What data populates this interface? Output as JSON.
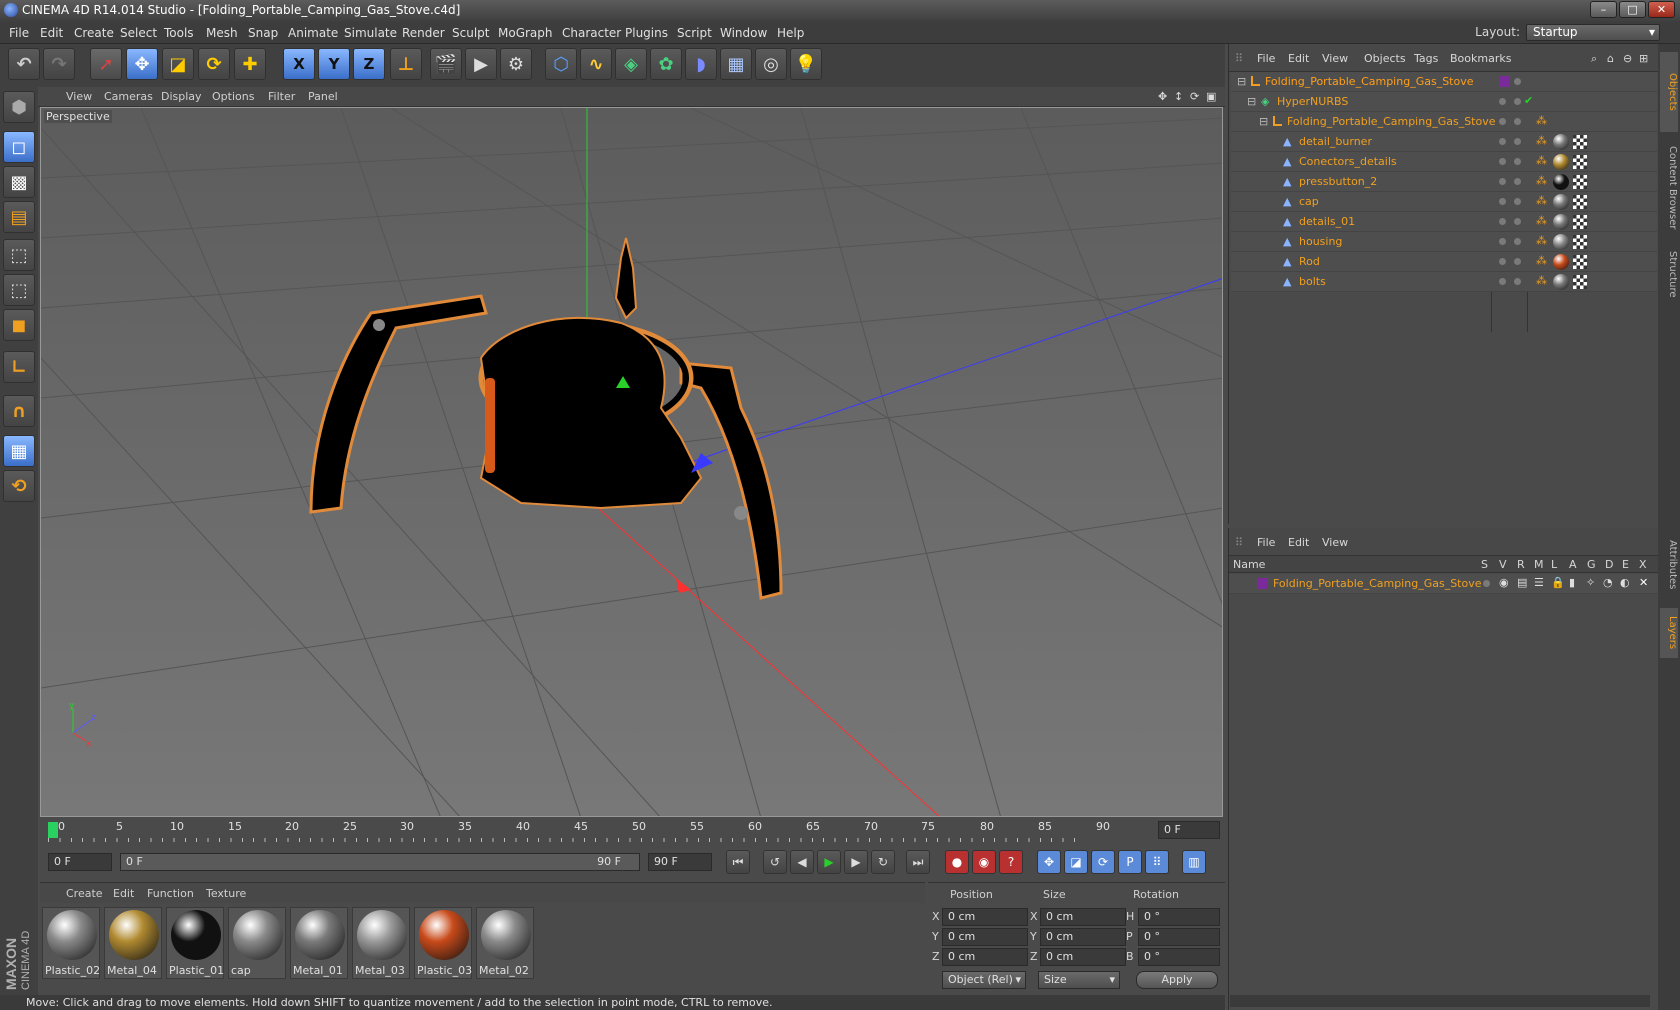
{
  "window": {
    "title": "CINEMA 4D R14.014 Studio - [Folding_Portable_Camping_Gas_Stove.c4d]",
    "buttons": {
      "min": "–",
      "max": "□",
      "close": "✕"
    }
  },
  "menubar": {
    "items": [
      "File",
      "Edit",
      "Create",
      "Select",
      "Tools",
      "Mesh",
      "Snap",
      "Animate",
      "Simulate",
      "Render",
      "Sculpt",
      "MoGraph",
      "Character",
      "Plugins",
      "Script",
      "Window",
      "Help"
    ],
    "layout_label": "Layout:",
    "layout_value": "Startup"
  },
  "toolbar": {
    "axis_x": "X",
    "axis_y": "Y",
    "axis_z": "Z"
  },
  "viewport": {
    "menu": [
      "View",
      "Cameras",
      "Display",
      "Options",
      "Filter",
      "Panel"
    ],
    "label": "Perspective"
  },
  "timeline": {
    "ticks": [
      "0",
      "5",
      "10",
      "15",
      "20",
      "25",
      "30",
      "35",
      "40",
      "45",
      "50",
      "55",
      "60",
      "65",
      "70",
      "75",
      "80",
      "85",
      "90"
    ],
    "current_frame": "0 F",
    "start_field": "0 F",
    "range_start": "0 F",
    "range_end": "90 F",
    "end_field": "90 F"
  },
  "materials": {
    "menu": [
      "Create",
      "Edit",
      "Function",
      "Texture"
    ],
    "items": [
      {
        "name": "Plastic_02",
        "color": "#8a8a8a"
      },
      {
        "name": "Metal_04",
        "color": "#b08a30"
      },
      {
        "name": "Plastic_01",
        "color": "#111111"
      },
      {
        "name": "cap",
        "color": "#8a8a8a"
      },
      {
        "name": "Metal_01",
        "color": "#7a7a7a"
      },
      {
        "name": "Metal_03",
        "color": "#9a9a9a"
      },
      {
        "name": "Plastic_03",
        "color": "#c84a1a"
      },
      {
        "name": "Metal_02",
        "color": "#8a8a8a"
      }
    ]
  },
  "coords": {
    "headers": {
      "position": "Position",
      "size": "Size",
      "rotation": "Rotation"
    },
    "rows": [
      {
        "axis": "X",
        "pos": "0 cm",
        "saxis": "X",
        "size": "0 cm",
        "raxis": "H",
        "rot": "0 °"
      },
      {
        "axis": "Y",
        "pos": "0 cm",
        "saxis": "Y",
        "size": "0 cm",
        "raxis": "P",
        "rot": "0 °"
      },
      {
        "axis": "Z",
        "pos": "0 cm",
        "saxis": "Z",
        "size": "0 cm",
        "raxis": "B",
        "rot": "0 °"
      }
    ],
    "mode": "Object (Rel)",
    "size_mode": "Size",
    "apply": "Apply"
  },
  "status": "Move: Click and drag to move elements. Hold down SHIFT to quantize movement / add to the selection in point mode, CTRL to remove.",
  "objects": {
    "menu": [
      "File",
      "Edit",
      "View",
      "Objects",
      "Tags",
      "Bookmarks"
    ],
    "tree": [
      {
        "name": "Folding_Portable_Camping_Gas_Stove",
        "level": 0
      },
      {
        "name": "HyperNURBS",
        "level": 1
      },
      {
        "name": "Folding_Portable_Camping_Gas_Stove",
        "level": 2
      },
      {
        "name": "detail_burner",
        "level": 3,
        "mat": "#777777"
      },
      {
        "name": "Conectors_details",
        "level": 3,
        "mat": "#b08a30"
      },
      {
        "name": "pressbutton_2",
        "level": 3,
        "mat": "#111111"
      },
      {
        "name": "cap",
        "level": 3,
        "mat": "#777777"
      },
      {
        "name": "details_01",
        "level": 3,
        "mat": "#777777"
      },
      {
        "name": "housing",
        "level": 3,
        "mat": "#888888"
      },
      {
        "name": "Rod",
        "level": 3,
        "mat": "#c84a1a"
      },
      {
        "name": "bolts",
        "level": 3,
        "mat": "#777777"
      }
    ]
  },
  "layers": {
    "menu": [
      "File",
      "Edit",
      "View"
    ],
    "columns": [
      "Name",
      "S",
      "V",
      "R",
      "M",
      "L",
      "A",
      "G",
      "D",
      "E",
      "X"
    ],
    "rows": [
      {
        "name": "Folding_Portable_Camping_Gas_Stove",
        "color": "#7a2a9a"
      }
    ]
  },
  "side_tabs": [
    "Objects",
    "Content Browser",
    "Structure",
    "Attributes",
    "Layers"
  ],
  "brand": {
    "maxon": "MAXON",
    "product": "CINEMA 4D"
  }
}
